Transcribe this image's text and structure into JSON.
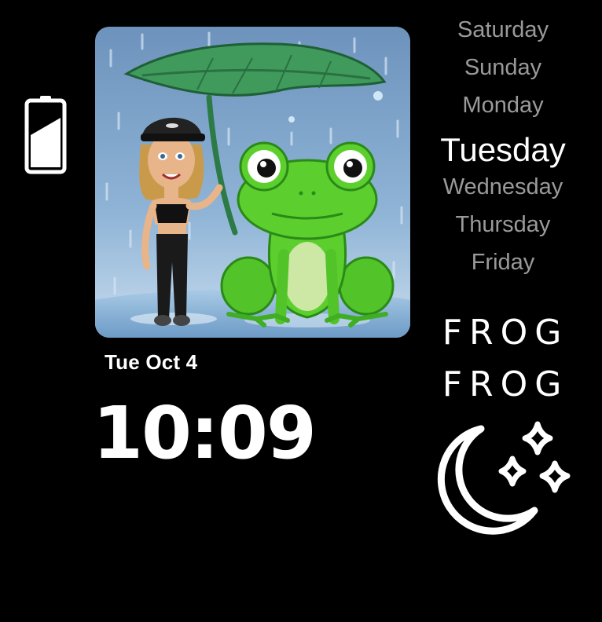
{
  "watch_face": {
    "battery_level": 0.5,
    "date": "Tue Oct 4",
    "time": "10:09",
    "weekdays": [
      "Saturday",
      "Sunday",
      "Monday",
      "Tuesday",
      "Wednesday",
      "Thursday",
      "Friday"
    ],
    "current_day": "Tuesday",
    "complication_text_1": "FROG",
    "complication_text_2": "FROG",
    "photo": "bitmoji girl under leaf umbrella with green frog in rain",
    "weather_icon": "moon-stars-icon"
  },
  "colors": {
    "background": "#000000",
    "text_primary": "#ffffff",
    "text_secondary": "#9a9a9a",
    "frog_green": "#5ccf2e",
    "leaf_green": "#3a9a5a",
    "sky": "#7ea5cc"
  }
}
